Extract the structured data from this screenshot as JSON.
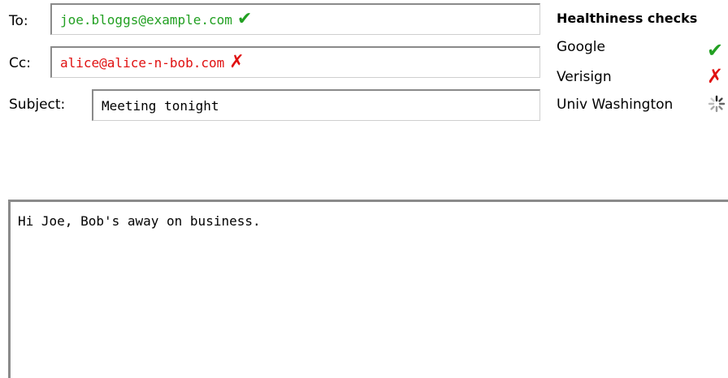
{
  "compose": {
    "to": {
      "label": "To:",
      "value": "joe.bloggs@example.com",
      "status": "valid",
      "status_color": "#22a022"
    },
    "cc": {
      "label": "Cc:",
      "value": "alice@alice-n-bob.com",
      "status": "invalid",
      "status_color": "#e01010"
    },
    "subject": {
      "label": "Subject:",
      "value": "Meeting tonight"
    },
    "body": "Hi Joe, Bob's away on business."
  },
  "healthiness": {
    "title": "Healthiness checks",
    "checks": [
      {
        "name": "Google",
        "status": "pass",
        "icon": "check-icon"
      },
      {
        "name": "Verisign",
        "status": "fail",
        "icon": "cross-icon"
      },
      {
        "name": "Univ Washington",
        "status": "loading",
        "icon": "spinner-icon"
      }
    ]
  }
}
